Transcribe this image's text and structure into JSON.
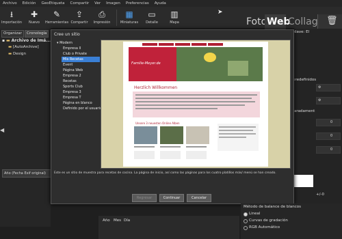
{
  "menu": [
    "Archivo",
    "Edición",
    "GeoEtiqueta",
    "Compartir",
    "Ver",
    "Imagen",
    "Preferencias",
    "Ayuda"
  ],
  "toolbar": {
    "items": [
      {
        "label": "Importación",
        "icon": "import-icon"
      },
      {
        "label": "Nuevo",
        "icon": "plus-icon"
      },
      {
        "label": "Herramientas",
        "icon": "brush-icon"
      },
      {
        "label": "Compartir",
        "icon": "share-icon"
      },
      {
        "label": "Impresión",
        "icon": "print-icon"
      },
      {
        "label": "Miniaturas",
        "icon": "grid-icon"
      },
      {
        "label": "Detalle",
        "icon": "detail-icon"
      },
      {
        "label": "Mapa",
        "icon": "map-icon"
      }
    ],
    "modes": [
      "Foto",
      "Web",
      "Collage"
    ],
    "active_mode": "Web"
  },
  "left_panel": {
    "tabs": [
      "Organizar",
      "Cronología"
    ],
    "tree_root": "Archivo de Imá...",
    "tree_items": [
      "[AutoArchive]",
      "Design"
    ],
    "footer": "Año (Fecha Exif original)"
  },
  "dialog": {
    "title": "Cree un sitio",
    "root": "Modern",
    "templates": [
      "Empresa II",
      "Club o Private",
      "Mis Recetas",
      "Event",
      "Página Web",
      "Empresa 2",
      "Recetas",
      "Sports Club",
      "Empresa 3",
      "Empresa T",
      "Página en blanco",
      "Definido por el usuario"
    ],
    "selected": "Mis Recetas",
    "description": "Este es un sitio de muestra para recetas de cocina. La página de inicio, así como las páginas para los cuatro platillos más/ menú se han creado.",
    "buttons": [
      "Regresar",
      "Continuar",
      "Cancelar"
    ],
    "preview": {
      "site_title": "Familie-Meyer.de",
      "welcome": "Herzlich Willkommen",
      "gallery_title": "Unsere 3 neuesten Online Alben"
    }
  },
  "right_panel": {
    "label_top": "dave: El",
    "section1": "predefinidos",
    "section2": "aradament",
    "values": [
      "0",
      "0",
      "0"
    ],
    "label_bottom": "+/-0"
  },
  "bottom_tabs": [
    "Año",
    "Mes",
    "Día"
  ],
  "white_balance": {
    "title": "Método de balance de blancos",
    "options": [
      "Lineal",
      "Curvas de gradación",
      "RGB Automático"
    ],
    "selected": "Lineal"
  },
  "colors": {
    "accent": "#3a7fd5",
    "dark_bg": "#1f1f1f",
    "banner": "#c0223a"
  }
}
